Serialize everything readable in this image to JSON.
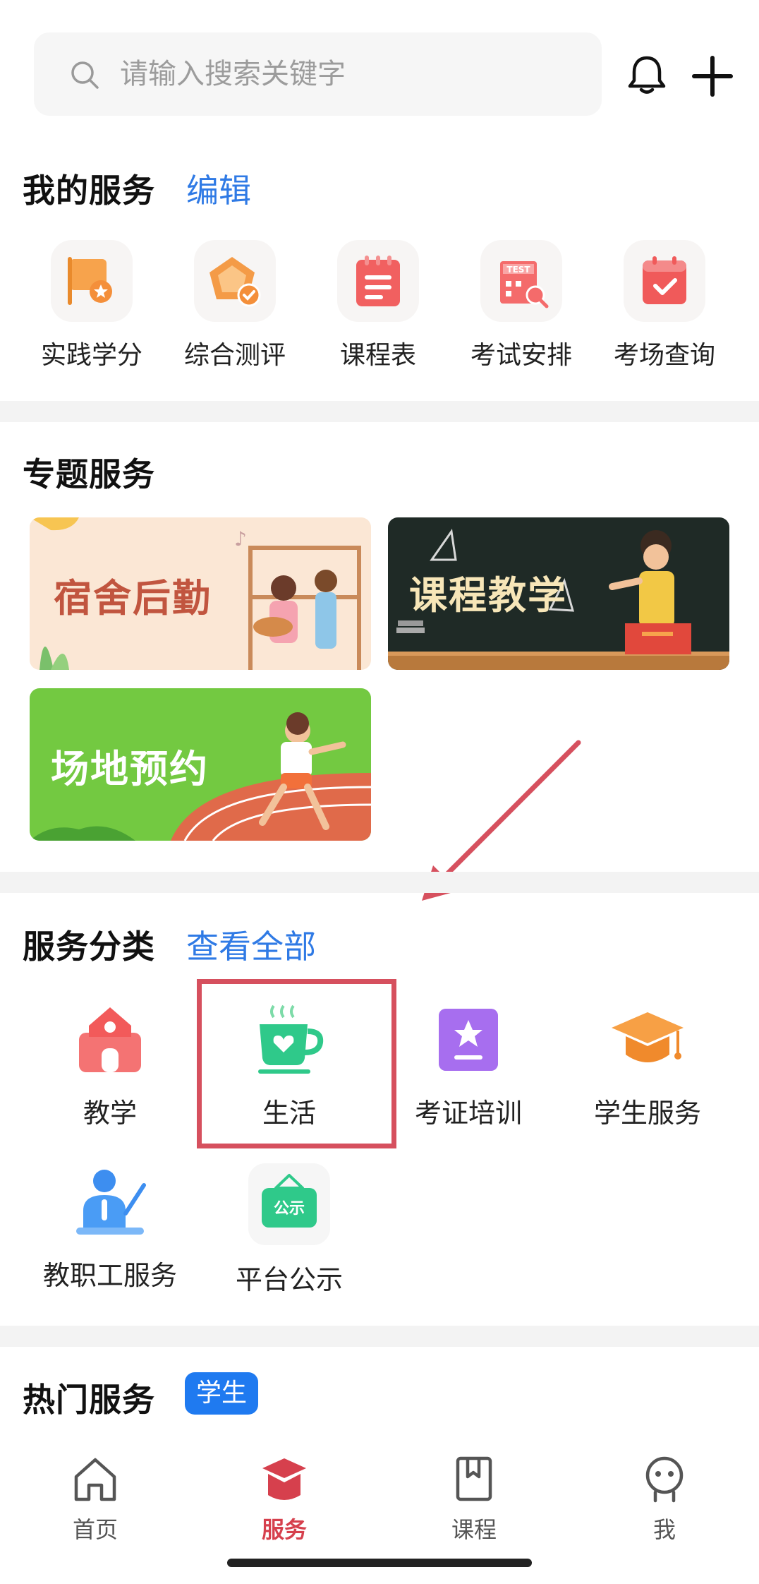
{
  "search": {
    "placeholder": "请输入搜索关键字"
  },
  "my_services": {
    "title": "我的服务",
    "edit_label": "编辑",
    "items": [
      {
        "label": "实践学分",
        "icon": "flag-star-icon"
      },
      {
        "label": "综合测评",
        "icon": "pentagon-check-icon"
      },
      {
        "label": "课程表",
        "icon": "notepad-icon"
      },
      {
        "label": "考试安排",
        "icon": "test-building-icon"
      },
      {
        "label": "考场查询",
        "icon": "calendar-check-icon"
      }
    ]
  },
  "topic_services": {
    "title": "专题服务",
    "banners": [
      {
        "title": "宿舍后勤"
      },
      {
        "title": "课程教学"
      },
      {
        "title": "场地预约"
      }
    ]
  },
  "categories": {
    "title": "服务分类",
    "view_all_label": "查看全部",
    "items": [
      {
        "label": "教学",
        "icon": "school-icon"
      },
      {
        "label": "生活",
        "icon": "coffee-cup-icon"
      },
      {
        "label": "考证培训",
        "icon": "certificate-icon"
      },
      {
        "label": "学生服务",
        "icon": "graduation-cap-icon"
      },
      {
        "label": "教职工服务",
        "icon": "teacher-icon"
      },
      {
        "label": "平台公示",
        "icon": "notice-board-icon",
        "icon_text": "公示"
      }
    ]
  },
  "hot_services": {
    "title": "热门服务",
    "badge": "学生"
  },
  "bottom_nav": {
    "items": [
      {
        "label": "首页",
        "icon": "home-icon"
      },
      {
        "label": "服务",
        "icon": "services-icon",
        "active": true
      },
      {
        "label": "课程",
        "icon": "book-icon"
      },
      {
        "label": "我",
        "icon": "profile-icon"
      }
    ]
  },
  "colors": {
    "accent_blue": "#2f7ae5",
    "accent_red": "#d6404d",
    "highlight": "#d6505e"
  }
}
